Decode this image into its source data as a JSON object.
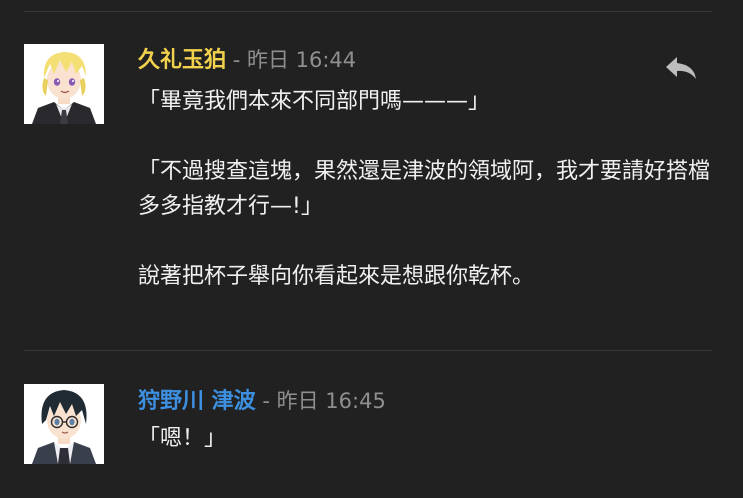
{
  "colors": {
    "background": "#212121",
    "divider": "#3a3a3a",
    "name_1": "#f2d14c",
    "name_2": "#3d8fe0",
    "meta": "#8f8f8f",
    "text": "#f0f0f0"
  },
  "messages": [
    {
      "author": "久礼玉狛",
      "separator": " - ",
      "timestamp": "昨日 16:44",
      "avatar_icon": "blonde-character-avatar",
      "reply_icon": "reply-icon",
      "paragraphs": [
        "「畢竟我們本來不同部門嗎———」",
        "「不過搜查這塊，果然還是津波的領域阿，我才要請好搭檔多多指教才行—!」",
        "說著把杯子舉向你看起來是想跟你乾杯。"
      ]
    },
    {
      "author": "狩野川 津波",
      "separator": " - ",
      "timestamp": "昨日 16:45",
      "avatar_icon": "dark-haired-glasses-character-avatar",
      "paragraphs": [
        "「嗯！」"
      ]
    }
  ]
}
